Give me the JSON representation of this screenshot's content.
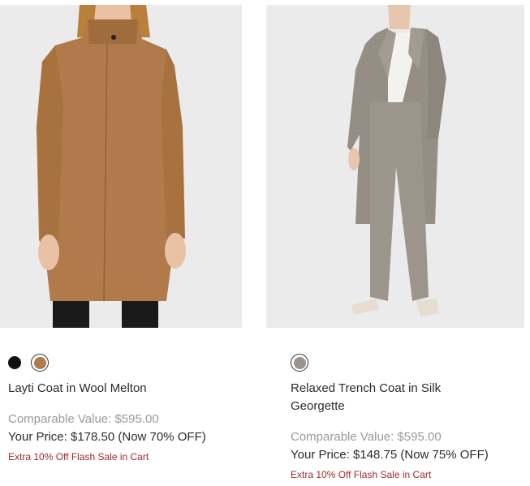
{
  "products": [
    {
      "name": "Layti Coat in Wool Melton",
      "comparable_value": "Comparable Value: $595.00",
      "your_price": "Your Price: $178.50 (Now 70% OFF)",
      "promo": "Extra 10% Off Flash Sale in Cart",
      "swatches": [
        {
          "color": "#111111",
          "selected": false
        },
        {
          "color": "#b07a4a",
          "selected": true
        }
      ]
    },
    {
      "name": "Relaxed Trench Coat in Silk Georgette",
      "comparable_value": "Comparable Value: $595.00",
      "your_price": "Your Price: $148.75 (Now 75% OFF)",
      "promo": "Extra 10% Off Flash Sale in Cart",
      "swatches": [
        {
          "color": "#9a948c",
          "selected": true
        }
      ]
    }
  ]
}
